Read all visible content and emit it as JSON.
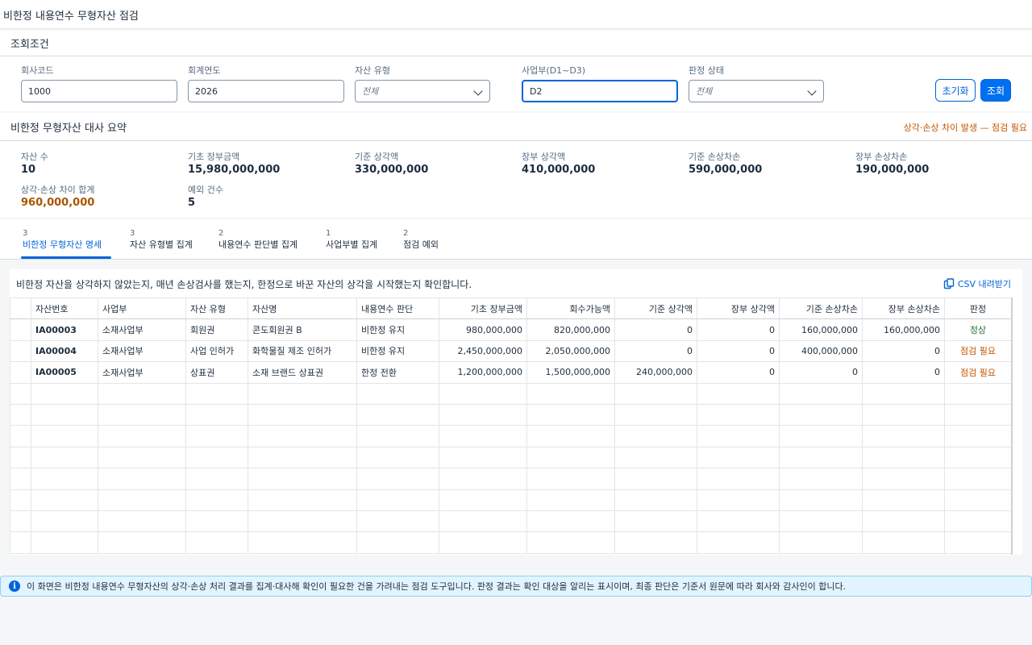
{
  "page": {
    "title": "비한정 내용연수 무형자산 점검"
  },
  "filters": {
    "section_title": "조회조건",
    "company_code": {
      "label": "회사코드",
      "value": "1000"
    },
    "fiscal_year": {
      "label": "회계연도",
      "value": "2026"
    },
    "asset_type": {
      "label": "자산 유형",
      "placeholder": "전체"
    },
    "division": {
      "label": "사업부(D1~D3)",
      "value": "D2"
    },
    "judgment_status": {
      "label": "판정 상태",
      "placeholder": "전체"
    },
    "reset_label": "초기화",
    "search_label": "조회"
  },
  "summary": {
    "title": "비한정 무형자산 대사 요약",
    "warning": "상각·손상 차이 발생 — 점검 필요",
    "kpis": [
      {
        "label": "자산 수",
        "value": "10"
      },
      {
        "label": "기초 장부금액",
        "value": "15,980,000,000"
      },
      {
        "label": "기준 상각액",
        "value": "330,000,000"
      },
      {
        "label": "장부 상각액",
        "value": "410,000,000"
      },
      {
        "label": "기준 손상차손",
        "value": "590,000,000"
      },
      {
        "label": "장부 손상차손",
        "value": "190,000,000"
      },
      {
        "label": "상각·손상 차이 합계",
        "value": "960,000,000"
      },
      {
        "label": "예외 건수",
        "value": "5"
      }
    ]
  },
  "tabs": [
    {
      "count": "3",
      "label": "비한정 무형자산 명세"
    },
    {
      "count": "3",
      "label": "자산 유형별 집계"
    },
    {
      "count": "2",
      "label": "내용연수 판단별 집계"
    },
    {
      "count": "1",
      "label": "사업부별 집계"
    },
    {
      "count": "2",
      "label": "점검 예외"
    }
  ],
  "table": {
    "description": "비한정 자산을 상각하지 않았는지, 매년 손상검사를 했는지, 한정으로 바꾼 자산의 상각을 시작했는지 확인합니다.",
    "csv_label": "CSV 내려받기",
    "columns": [
      "자산번호",
      "사업부",
      "자산 유형",
      "자산명",
      "내용연수 판단",
      "기초 장부금액",
      "회수가능액",
      "기준 상각액",
      "장부 상각액",
      "기준 손상차손",
      "장부 손상차손",
      "판정"
    ],
    "rows": [
      [
        "IA00003",
        "소재사업부",
        "회원권",
        "콘도회원권 B",
        "비한정 유지",
        "980,000,000",
        "820,000,000",
        "0",
        "0",
        "160,000,000",
        "160,000,000",
        "정상"
      ],
      [
        "IA00004",
        "소재사업부",
        "사업 인허가",
        "화학물질 제조 인허가",
        "비한정 유지",
        "2,450,000,000",
        "2,050,000,000",
        "0",
        "0",
        "400,000,000",
        "0",
        "점검 필요"
      ],
      [
        "IA00005",
        "소재사업부",
        "상표권",
        "소재 브랜드 상표권",
        "한정 전환",
        "1,200,000,000",
        "1,500,000,000",
        "240,000,000",
        "0",
        "0",
        "0",
        "점검 필요"
      ]
    ]
  },
  "info": {
    "text": "이 화면은 비한정 내용연수 무형자산의 상각·손상 처리 결과를 집계·대사해 확인이 필요한 건을 가려내는 점검 도구입니다. 판정 결과는 확인 대상을 알리는 표시이며, 최종 판단은 기준서 원문에 따라 회사와 감사인이 합니다."
  },
  "colors": {
    "accent": "#0064d9",
    "warning": "#c35500",
    "ok": "#256f3a"
  }
}
